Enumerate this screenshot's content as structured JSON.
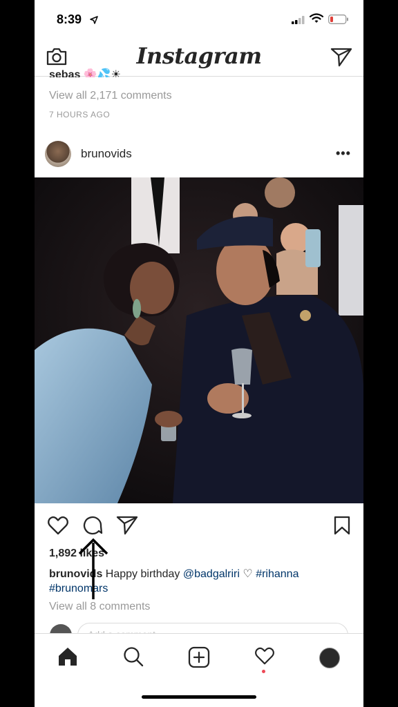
{
  "status_bar": {
    "time": "8:39"
  },
  "nav": {
    "title": "Instagram"
  },
  "previous_post": {
    "caption_fragment": "sebas",
    "caption_emojis": "🌸💦☀",
    "view_all_comments": "View all 2,171 comments",
    "time_ago": "7 HOURS AGO"
  },
  "post": {
    "username": "brunovids",
    "more_label": "•••",
    "likes": "1,892 likes",
    "caption": {
      "username": "brunovids",
      "text": "Happy birthday",
      "mention": "@badgalriri",
      "heart": "♡",
      "hashtag1": "#rihanna",
      "hashtag2": "#brunomars"
    },
    "view_all_comments": "View all 8 comments",
    "add_comment_placeholder": "Add a comment..."
  },
  "colors": {
    "link": "#003569",
    "muted": "#999999",
    "notification_dot": "#ed4956",
    "battery_low": "#e0403a"
  },
  "icons": {
    "status": [
      "location-arrow-icon",
      "signal-icon",
      "wifi-icon",
      "battery-icon"
    ],
    "nav": [
      "camera-icon",
      "direct-message-icon"
    ],
    "actions": [
      "heart-icon",
      "comment-icon",
      "share-icon",
      "bookmark-icon"
    ],
    "tabs": [
      "home-icon",
      "search-icon",
      "add-post-icon",
      "activity-heart-icon",
      "profile-avatar"
    ]
  }
}
